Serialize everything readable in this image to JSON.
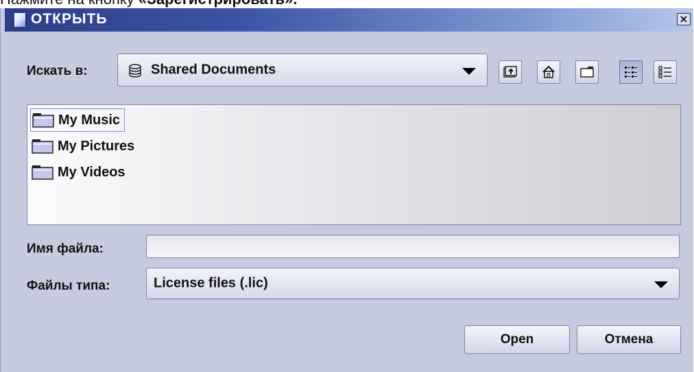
{
  "caption": {
    "prefix": "Нажмите на кнопку ",
    "bold": "«Зарегистрировать»."
  },
  "dialog": {
    "title": "ОТКРЫТЬ",
    "close_label": "×",
    "look_in_label": "Искать в:",
    "look_in_value": "Shared Documents",
    "toolbar": {
      "up_icon": "up-folder-icon",
      "home_icon": "home-icon",
      "new_folder_icon": "new-folder-icon",
      "list_view_icon": "list-view-icon",
      "details_view_icon": "details-view-icon"
    },
    "files": [
      {
        "name": "My Music",
        "selected": true
      },
      {
        "name": "My Pictures",
        "selected": false
      },
      {
        "name": "My Videos",
        "selected": false
      }
    ],
    "filename_label": "Имя файла:",
    "filename_value": "",
    "filetype_label": "Файлы типа:",
    "filetype_value": "License files (.lic)",
    "open_button": "Open",
    "cancel_button": "Отмена"
  }
}
